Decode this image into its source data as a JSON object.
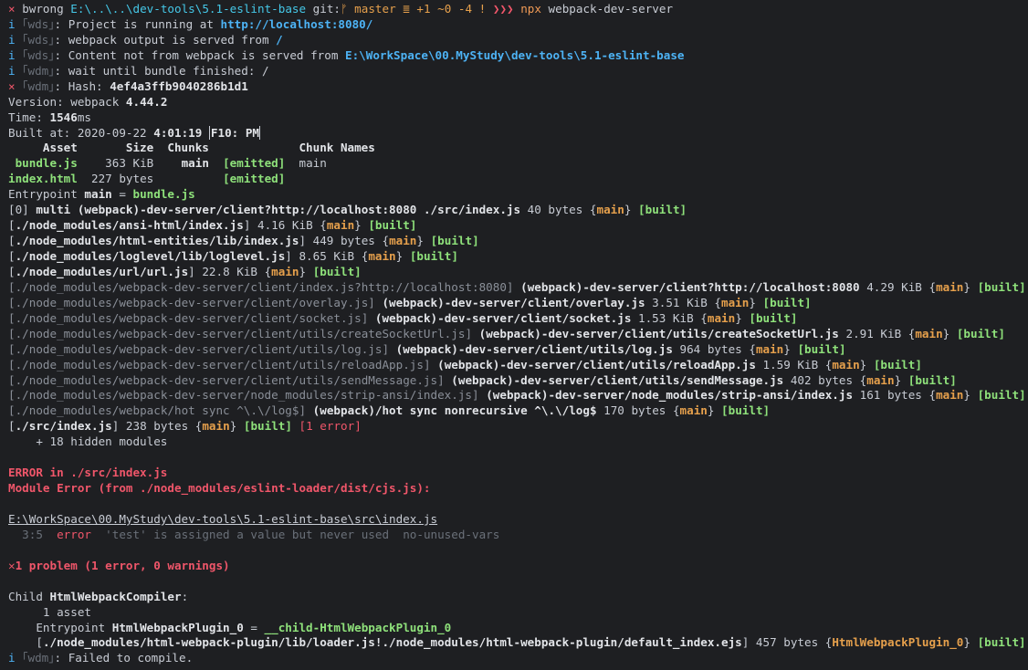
{
  "prompt": {
    "user": "bwrong",
    "path": "E:\\..\\..\\dev-tools\\5.1-eslint-base",
    "git_label": "git:",
    "branch_icon": "branch-icon",
    "branch_glyph": "ᚠ",
    "branch": "master",
    "status": "≣ +1 ~0 -4 !",
    "arrows": "❯❯❯",
    "cmd": "npx",
    "args": "webpack-dev-server"
  },
  "wds": {
    "l1_pre": ": Project is running at ",
    "l1_url": "http://localhost:8080/",
    "l2_pre": ": webpack output is served from ",
    "l2_val": "/",
    "l3_pre": ": Content not from webpack is served from ",
    "l3_val": "E:\\WorkSpace\\00.MyStudy\\dev-tools\\5.1-eslint-base",
    "l4": ": wait until bundle finished: /",
    "hash_pre": ": Hash: ",
    "hash": "4ef4a3ffb9040286b1d1"
  },
  "tags": {
    "info": "i",
    "cross": "×",
    "wds": "｢wds｣",
    "wdm": "｢wdm｣"
  },
  "build": {
    "version_label": "Version: webpack ",
    "version": "4.44.2",
    "time_label": "Time: ",
    "time": "1546",
    "time_unit": "ms",
    "built_label": "Built at: 2020-09-22 ",
    "built_time": "4:01:19",
    "built_tail": "F10: PM"
  },
  "assets": {
    "header": "     Asset       Size  Chunks             Chunk Names",
    "rows": [
      {
        "name": " bundle.js",
        "size": "    363 KiB ",
        "chunk": "   main",
        "status": "[emitted]",
        "names": "  main"
      },
      {
        "name": "index.html",
        "size": "  227 bytes ",
        "chunk": "       ",
        "status": "[emitted]",
        "names": ""
      }
    ]
  },
  "entry": {
    "label": "Entrypoint ",
    "name": "main",
    "eq": " = ",
    "file": "bundle.js"
  },
  "modules": {
    "m0": {
      "pre": "[0] ",
      "name": "multi (webpack)-dev-server/client?http://localhost:8080 ./src/index.js",
      "size": " 40 bytes ",
      "chunk": "main",
      "built": "[built]"
    },
    "m1": {
      "path": "./node_modules/ansi-html/index.js",
      "size": " 4.16 KiB ",
      "chunk": "main",
      "built": "[built]"
    },
    "m2": {
      "path": "./node_modules/html-entities/lib/index.js",
      "size": " 449 bytes ",
      "chunk": "main",
      "built": "[built]"
    },
    "m3": {
      "path": "./node_modules/loglevel/lib/loglevel.js",
      "size": " 8.65 KiB ",
      "chunk": "main",
      "built": "[built]"
    },
    "m4": {
      "path": "./node_modules/url/url.js",
      "size": " 22.8 KiB ",
      "chunk": "main",
      "built": "[built]"
    },
    "m5": {
      "path": "./node_modules/webpack-dev-server/client/index.js?http://localhost:8080",
      "name": "(webpack)-dev-server/client?http://localhost:8080",
      "size": " 4.29 KiB ",
      "chunk": "main",
      "built": "[built]"
    },
    "m6": {
      "path": "./node_modules/webpack-dev-server/client/overlay.js",
      "name": "(webpack)-dev-server/client/overlay.js",
      "size": " 3.51 KiB ",
      "chunk": "main",
      "built": "[built]"
    },
    "m7": {
      "path": "./node_modules/webpack-dev-server/client/socket.js",
      "name": "(webpack)-dev-server/client/socket.js",
      "size": " 1.53 KiB ",
      "chunk": "main",
      "built": "[built]"
    },
    "m8": {
      "path": "./node_modules/webpack-dev-server/client/utils/createSocketUrl.js",
      "name": "(webpack)-dev-server/client/utils/createSocketUrl.js",
      "size": " 2.91 KiB ",
      "chunk": "main",
      "built": "[built]"
    },
    "m9": {
      "path": "./node_modules/webpack-dev-server/client/utils/log.js",
      "name": "(webpack)-dev-server/client/utils/log.js",
      "size": " 964 bytes ",
      "chunk": "main",
      "built": "[built]"
    },
    "m10": {
      "path": "./node_modules/webpack-dev-server/client/utils/reloadApp.js",
      "name": "(webpack)-dev-server/client/utils/reloadApp.js",
      "size": " 1.59 KiB ",
      "chunk": "main",
      "built": "[built]"
    },
    "m11": {
      "path": "./node_modules/webpack-dev-server/client/utils/sendMessage.js",
      "name": "(webpack)-dev-server/client/utils/sendMessage.js",
      "size": " 402 bytes ",
      "chunk": "main",
      "built": "[built]"
    },
    "m12": {
      "path": "./node_modules/webpack-dev-server/node_modules/strip-ansi/index.js",
      "name": "(webpack)-dev-server/node_modules/strip-ansi/index.js",
      "size": " 161 bytes ",
      "chunk": "main",
      "built": "[built]"
    },
    "m13": {
      "path": "./node_modules/webpack/hot sync ^\\.\\/log$",
      "name": "(webpack)/hot sync nonrecursive ^\\.\\/log$",
      "size": " 170 bytes ",
      "chunk": "main",
      "built": "[built]"
    },
    "m14": {
      "path": "./src/index.js",
      "size": " 238 bytes ",
      "chunk": "main",
      "built": "[built]",
      "error": "[1 error]"
    },
    "hidden": "    + 18 hidden modules"
  },
  "error": {
    "title": "ERROR in ./src/index.js",
    "module": "Module Error (from ./node_modules/eslint-loader/dist/cjs.js):",
    "file": "E:\\WorkSpace\\00.MyStudy\\dev-tools\\5.1-eslint-base\\src\\index.js",
    "loc": "  3:5  ",
    "level": "error",
    "message": "  'test' is assigned a value but never used  no-unused-vars",
    "summary": "✕1 problem (1 error, 0 warnings)"
  },
  "child": {
    "label": "Child ",
    "name": "HtmlWebpackCompiler",
    "colon": ":",
    "asset": "     1 asset",
    "entry_label": "    Entrypoint ",
    "entry_name": "HtmlWebpackPlugin_0",
    "entry_eq": " = ",
    "entry_file": "__child-HtmlWebpackPlugin_0",
    "mod_indent": "    ",
    "mod_path": "./node_modules/html-webpack-plugin/lib/loader.js!./node_modules/html-webpack-plugin/default_index.ejs",
    "mod_size": " 457 bytes ",
    "mod_chunk": "HtmlWebpackPlugin_0",
    "mod_built": "[built]"
  },
  "final": ": Failed to compile.",
  "colors": {
    "background": "#1e1f22",
    "green": "#8fe27b",
    "red": "#f0566a",
    "yellow": "#e6a04c",
    "cyan": "#45c8e8",
    "blue": "#4db3f5"
  }
}
